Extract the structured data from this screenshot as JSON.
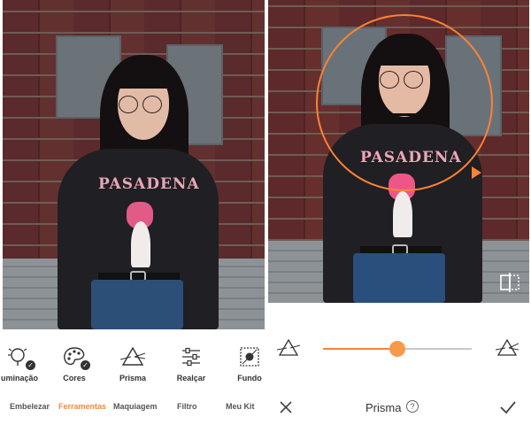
{
  "tools": [
    {
      "label": "uminação",
      "icon": "lightbulb-icon",
      "badge": true
    },
    {
      "label": "Cores",
      "icon": "palette-icon",
      "badge": true
    },
    {
      "label": "Prisma",
      "icon": "prism-icon",
      "badge": false
    },
    {
      "label": "Realçar",
      "icon": "sliders-icon",
      "badge": false
    },
    {
      "label": "Fundo",
      "icon": "background-icon",
      "badge": false
    }
  ],
  "nav": [
    {
      "label": "Embelezar",
      "active": false
    },
    {
      "label": "Ferramentas",
      "active": true
    },
    {
      "label": "Maquiagem",
      "active": false
    },
    {
      "label": "Filtro",
      "active": false
    },
    {
      "label": "Meu Kit",
      "active": false
    }
  ],
  "shirt_print": "PASADENA",
  "adjust": {
    "title": "Prisma",
    "help_symbol": "?",
    "slider_value_fraction": 0.5
  },
  "colors": {
    "accent": "#f4843d",
    "active_nav": "#f08a3a"
  }
}
